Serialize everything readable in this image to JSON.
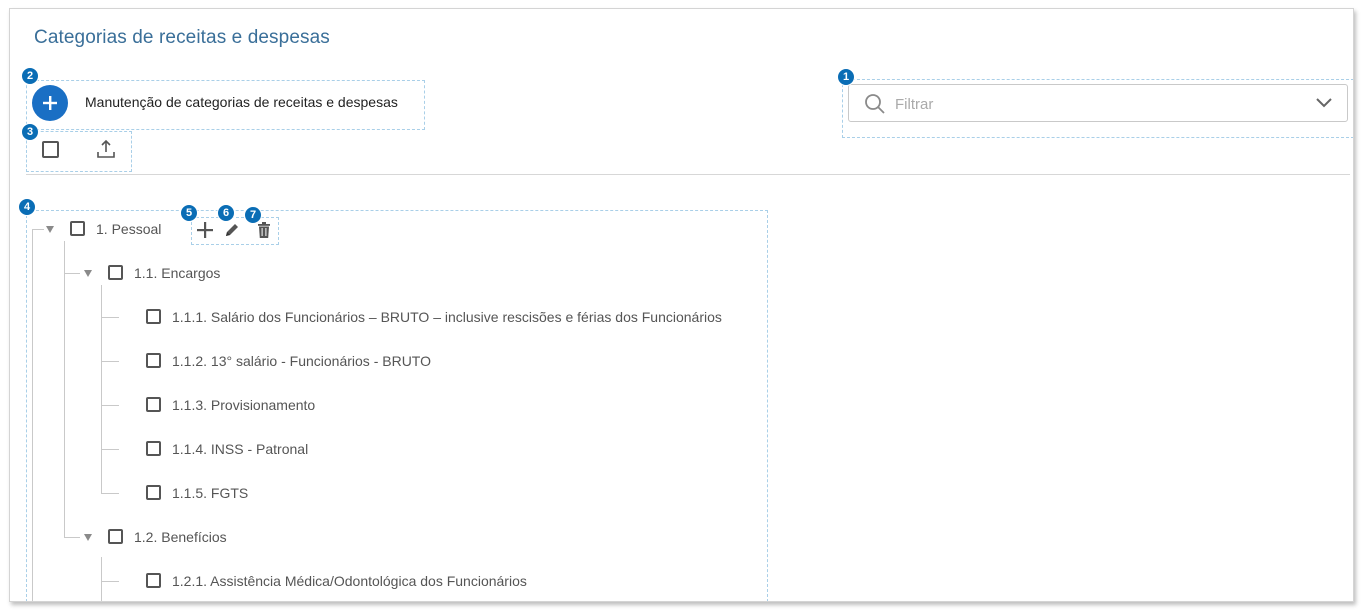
{
  "page": {
    "title": "Categorias de receitas e despesas"
  },
  "toolbar": {
    "add_label": "Manutenção de categorias de receitas e despesas"
  },
  "filter": {
    "placeholder": "Filtrar",
    "value": ""
  },
  "badges": [
    "1",
    "2",
    "3",
    "4",
    "5",
    "6",
    "7"
  ],
  "tree": {
    "root": {
      "label": "1. Pessoal",
      "expanded": true
    },
    "groups": [
      {
        "label": "1.1. Encargos",
        "expanded": true,
        "items": [
          "1.1.1. Salário dos Funcionários – BRUTO – inclusive rescisões e férias dos Funcionários",
          "1.1.2. 13° salário - Funcionários - BRUTO",
          "1.1.3. Provisionamento",
          "1.1.4. INSS - Patronal",
          "1.1.5. FGTS"
        ]
      },
      {
        "label": "1.2. Benefícios",
        "expanded": true,
        "items": [
          "1.2.1. Assistência Médica/Odontológica dos Funcionários"
        ]
      }
    ]
  },
  "icons": {
    "add": "plus-icon",
    "edit": "pencil-icon",
    "delete": "trash-icon",
    "upload": "upload-icon",
    "search": "search-icon",
    "dropdown": "chevron-down-icon"
  },
  "colors": {
    "accent": "#1a6fc4",
    "badge": "#0a6db5",
    "title": "#3a6f99",
    "dashed_outline": "#a9cfe8"
  }
}
